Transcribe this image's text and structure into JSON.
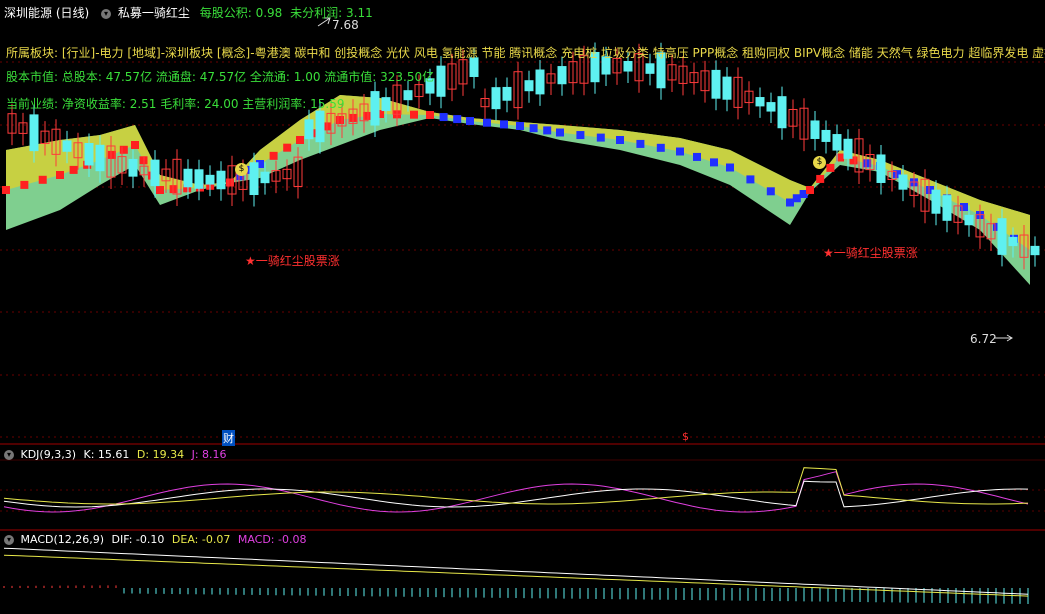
{
  "header": {
    "stock_name": "深圳能源",
    "period": "(日线)",
    "indicator_name": "私募一骑红尘",
    "eps_label": "每股公积:",
    "eps_value": "0.98",
    "undist_label": "未分利润:",
    "undist_value": "3.11"
  },
  "info": {
    "sector_line": "所属板块: [行业]-电力 [地域]-深圳板块 [概念]-粤港澳 碳中和 创投概念 光伏 风电 氢能源 节能 腾讯概念 充电桩 垃圾分类 特高压 PPP概念 租购同权 BIPV概念 储能 天然气 绿色电力 超临界发电 虚拟电厂",
    "capital_line": "股本市值: 总股本: 47.57亿 流通盘: 47.57亿 全流通: 1.00 流通市值: 323.50亿",
    "perf_line": "当前业绩: 净资收益率: 2.51 毛利率: 24.00 主营利润率: 15.59"
  },
  "annotations": {
    "high_price": "7.68",
    "low_price": "6.72",
    "signal_label": "★一骑红尘股票涨",
    "finance_mark": "财",
    "dollar_mark": "$",
    "money_mark": "$"
  },
  "kdj": {
    "name": "KDJ(9,3,3)",
    "k_label": "K: 15.61",
    "d_label": "D: 19.34",
    "j_label": "J: 8.16"
  },
  "macd": {
    "name": "MACD(12,26,9)",
    "dif_label": "DIF: -0.10",
    "dea_label": "DEA: -0.07",
    "macd_label": "MACD: -0.08"
  },
  "colors": {
    "up": "#ff3b3b",
    "down": "#5ef0f0",
    "header_yellow": "#e8d84a",
    "info_green": "#3adf3a",
    "band_upper": "#cfcf3a",
    "band_lower": "#7fcf8f",
    "band_gray": "#b4a6c6",
    "k_line": "#ffffff",
    "d_line": "#e8e84a",
    "j_line": "#e040e0"
  },
  "chart_data": {
    "type": "candlestick",
    "price_markers": {
      "high": 7.68,
      "low": 6.72
    }
  }
}
